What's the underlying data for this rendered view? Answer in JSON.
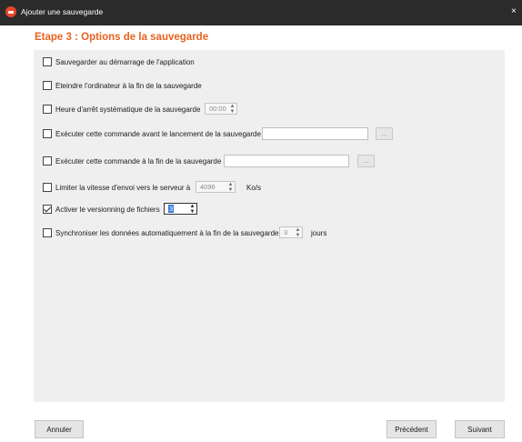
{
  "window": {
    "title": "Ajouter une sauvegarde",
    "close_glyph": "×"
  },
  "header": {
    "step_title": "Etape 3 :   Options de la sauvegarde",
    "accent_color": "#e8621f"
  },
  "options": {
    "startup": {
      "label": "Sauvegarder au démarrage de l'application",
      "checked": false
    },
    "shutdown": {
      "label": "Eteindre l'ordinateur à la fin de la sauvegarde",
      "checked": false
    },
    "stop_time": {
      "label": "Heure d'arrêt systématique de la sauvegarde",
      "checked": false,
      "value": "00:00"
    },
    "cmd_before": {
      "label": "Exécuter cette commande avant le lancement de la sauvegarde",
      "checked": false,
      "value": "",
      "browse_label": "..."
    },
    "cmd_after": {
      "label": "Exécuter cette commande à la fin de la sauvegarde",
      "checked": false,
      "value": "",
      "browse_label": "..."
    },
    "speed_limit": {
      "label": "Limiter la vitesse d'envoi vers le serveur à",
      "checked": false,
      "value": "4096",
      "unit": "Ko/s"
    },
    "versioning": {
      "label": "Activer le versionning de fichiers",
      "checked": true,
      "value": "3"
    },
    "auto_sync": {
      "label": "Synchroniser les données automatiquement à la fin de la sauvegarde",
      "checked": false,
      "value": "3",
      "unit": "jours"
    }
  },
  "spinner_arrows": {
    "up": "▲",
    "down": "▼"
  },
  "footer": {
    "cancel_label": "Annuler",
    "previous_label": "Précédent",
    "next_label": "Suivant"
  },
  "colors": {
    "titlebar": "#2b2b2b",
    "app_icon": "#e8472a",
    "panel": "#efefef",
    "selection": "#3d7ae0"
  },
  "icons": {
    "app": "sauvegarde-app-icon",
    "close": "close-icon"
  }
}
